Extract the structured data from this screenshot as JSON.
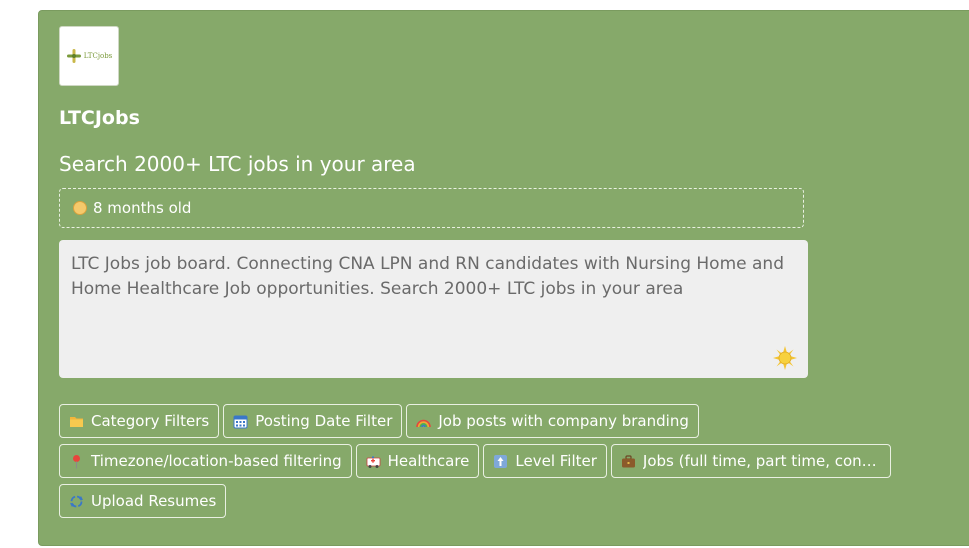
{
  "listing": {
    "logo_text": "LTCjobs",
    "name": "LTCJobs",
    "tagline": "Search 2000+ LTC jobs in your area",
    "age": "8 months old",
    "description": "LTC Jobs job board. Connecting CNA LPN and RN candidates with Nursing Home and Home Healthcare Job opportunities. Search 2000+ LTC jobs in your area",
    "features": [
      {
        "label": "Category Filters",
        "icon": "folder-icon"
      },
      {
        "label": "Posting Date Filter",
        "icon": "calendar-icon"
      },
      {
        "label": "Job posts with company branding",
        "icon": "rainbow-icon"
      },
      {
        "label": "Timezone/location-based filtering",
        "icon": "pin-icon"
      },
      {
        "label": "Healthcare",
        "icon": "ambulance-icon"
      },
      {
        "label": "Level Filter",
        "icon": "level-icon"
      },
      {
        "label": "Jobs (full time, part time, contr...",
        "icon": "briefcase-icon"
      },
      {
        "label": "Upload Resumes",
        "icon": "arrows-cycle-icon"
      }
    ]
  },
  "colors": {
    "card_bg": "#86a96a",
    "description_bg": "#efefef",
    "text_light": "#ffffff"
  }
}
